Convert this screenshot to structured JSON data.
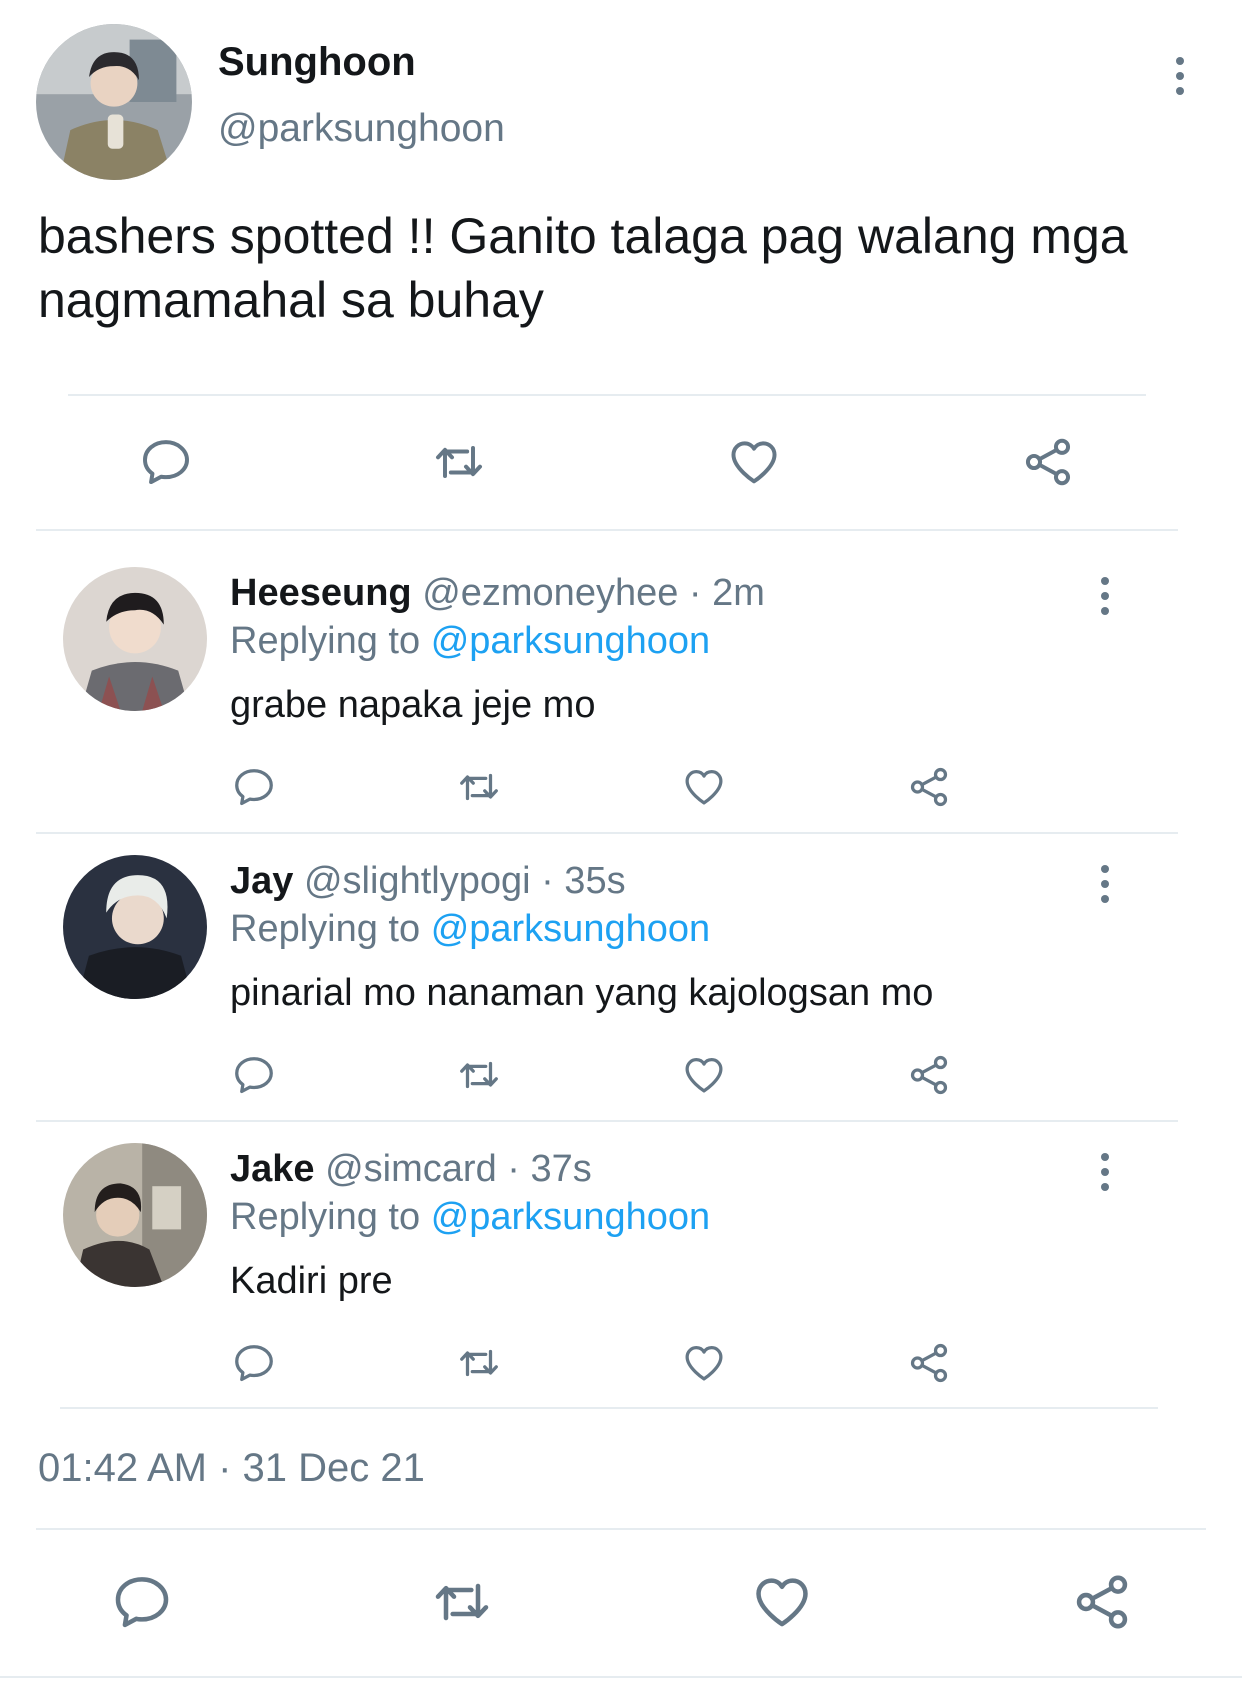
{
  "main_tweet": {
    "name": "Sunghoon",
    "handle": "@parksunghoon",
    "text": "bashers spotted !! Ganito talaga pag walang mga nagmamahal sa buhay",
    "timestamp": "01:42 AM · 31 Dec 21"
  },
  "replies": [
    {
      "name": "Heeseung",
      "meta": "@ezmoneyhee · 2m",
      "replying_label": "Replying to",
      "replying_to": "@parksunghoon",
      "text": "grabe napaka jeje mo"
    },
    {
      "name": "Jay",
      "meta": "@slightlypogi · 35s",
      "replying_label": "Replying to",
      "replying_to": "@parksunghoon",
      "text": "pinarial mo nanaman yang kajologsan mo"
    },
    {
      "name": "Jake",
      "meta": "@simcard · 37s",
      "replying_label": "Replying to",
      "replying_to": "@parksunghoon",
      "text": "Kadiri pre"
    }
  ],
  "icons": [
    "reply-icon",
    "retweet-icon",
    "like-icon",
    "share-icon",
    "more-icon"
  ],
  "colors": {
    "text": "#14171a",
    "muted": "#657786",
    "link": "#1da1f2",
    "divider": "#e6ecf0"
  }
}
